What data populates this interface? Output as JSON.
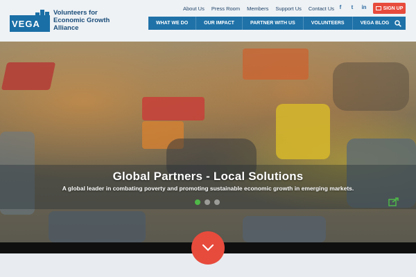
{
  "brand": {
    "logo_text": "VEGA",
    "tagline_line1": "Volunteers for",
    "tagline_line2": "Economic Growth",
    "tagline_line3": "Alliance"
  },
  "utility_nav": [
    "About Us",
    "Press Room",
    "Members",
    "Support Us",
    "Contact Us"
  ],
  "social": {
    "icons": [
      "facebook-icon",
      "twitter-icon",
      "linkedin-icon"
    ],
    "glyphs": [
      "f",
      "t",
      "in"
    ]
  },
  "signup": {
    "label": "SIGN UP"
  },
  "main_nav": [
    "WHAT WE DO",
    "OUR IMPACT",
    "PARTNER WITH US",
    "VOLUNTEERS",
    "VEGA BLOG"
  ],
  "hero": {
    "title": "Global Partners - Local Solutions",
    "subtitle": "A global leader in combating poverty and promoting sustainable economic growth in emerging markets.",
    "slides": 3,
    "active_slide": 1
  },
  "colors": {
    "accent": "#e74b3c",
    "nav": "#1f72a8",
    "active_dot": "#4fb848",
    "brand": "#0b4a7a"
  }
}
